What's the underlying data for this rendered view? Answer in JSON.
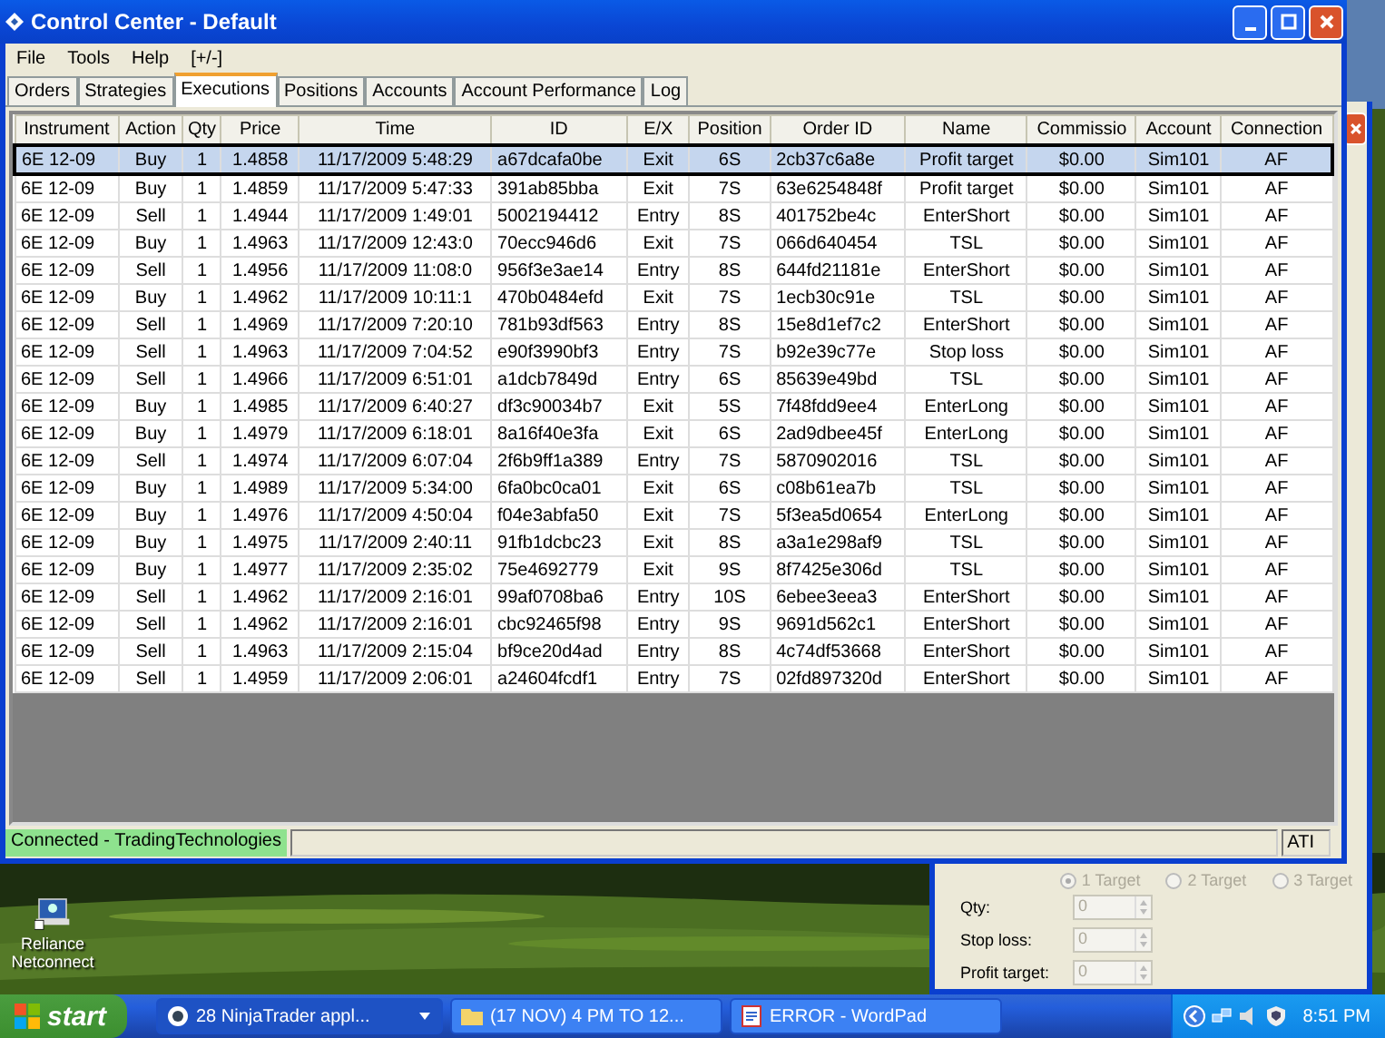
{
  "window": {
    "title": "Control Center - Default"
  },
  "menu": [
    "File",
    "Tools",
    "Help",
    "[+/-]"
  ],
  "tabs": [
    {
      "label": "Orders",
      "selected": false
    },
    {
      "label": "Strategies",
      "selected": false
    },
    {
      "label": "Executions",
      "selected": true
    },
    {
      "label": "Positions",
      "selected": false
    },
    {
      "label": "Accounts",
      "selected": false
    },
    {
      "label": "Account Performance",
      "selected": false
    },
    {
      "label": "Log",
      "selected": false
    }
  ],
  "table": {
    "columns": [
      "Instrument",
      "Action",
      "Qty",
      "Price",
      "Time",
      "ID",
      "E/X",
      "Position",
      "Order ID",
      "Name",
      "Commissio",
      "Account",
      "Connection"
    ],
    "rows": [
      {
        "selected": true,
        "cells": [
          "6E 12-09",
          "Buy",
          "1",
          "1.4858",
          "11/17/2009 5:48:29",
          "a67dcafa0be",
          "Exit",
          "6S",
          "2cb37c6a8e",
          "Profit target",
          "$0.00",
          "Sim101",
          "AF"
        ]
      },
      {
        "selected": false,
        "cells": [
          "6E 12-09",
          "Buy",
          "1",
          "1.4859",
          "11/17/2009 5:47:33",
          "391ab85bba",
          "Exit",
          "7S",
          "63e6254848f",
          "Profit target",
          "$0.00",
          "Sim101",
          "AF"
        ]
      },
      {
        "selected": false,
        "cells": [
          "6E 12-09",
          "Sell",
          "1",
          "1.4944",
          "11/17/2009 1:49:01",
          "5002194412",
          "Entry",
          "8S",
          "401752be4c",
          "EnterShort",
          "$0.00",
          "Sim101",
          "AF"
        ]
      },
      {
        "selected": false,
        "cells": [
          "6E 12-09",
          "Buy",
          "1",
          "1.4963",
          "11/17/2009 12:43:0",
          "70ecc946d6",
          "Exit",
          "7S",
          "066d640454",
          "TSL",
          "$0.00",
          "Sim101",
          "AF"
        ]
      },
      {
        "selected": false,
        "cells": [
          "6E 12-09",
          "Sell",
          "1",
          "1.4956",
          "11/17/2009 11:08:0",
          "956f3e3ae14",
          "Entry",
          "8S",
          "644fd21181e",
          "EnterShort",
          "$0.00",
          "Sim101",
          "AF"
        ]
      },
      {
        "selected": false,
        "cells": [
          "6E 12-09",
          "Buy",
          "1",
          "1.4962",
          "11/17/2009 10:11:1",
          "470b0484efd",
          "Exit",
          "7S",
          "1ecb30c91e",
          "TSL",
          "$0.00",
          "Sim101",
          "AF"
        ]
      },
      {
        "selected": false,
        "cells": [
          "6E 12-09",
          "Sell",
          "1",
          "1.4969",
          "11/17/2009 7:20:10",
          "781b93df563",
          "Entry",
          "8S",
          "15e8d1ef7c2",
          "EnterShort",
          "$0.00",
          "Sim101",
          "AF"
        ]
      },
      {
        "selected": false,
        "cells": [
          "6E 12-09",
          "Sell",
          "1",
          "1.4963",
          "11/17/2009 7:04:52",
          "e90f3990bf3",
          "Entry",
          "7S",
          "b92e39c77e",
          "Stop loss",
          "$0.00",
          "Sim101",
          "AF"
        ]
      },
      {
        "selected": false,
        "cells": [
          "6E 12-09",
          "Sell",
          "1",
          "1.4966",
          "11/17/2009 6:51:01",
          "a1dcb7849d",
          "Entry",
          "6S",
          "85639e49bd",
          "TSL",
          "$0.00",
          "Sim101",
          "AF"
        ]
      },
      {
        "selected": false,
        "cells": [
          "6E 12-09",
          "Buy",
          "1",
          "1.4985",
          "11/17/2009 6:40:27",
          "df3c90034b7",
          "Exit",
          "5S",
          "7f48fdd9ee4",
          "EnterLong",
          "$0.00",
          "Sim101",
          "AF"
        ]
      },
      {
        "selected": false,
        "cells": [
          "6E 12-09",
          "Buy",
          "1",
          "1.4979",
          "11/17/2009 6:18:01",
          "8a16f40e3fa",
          "Exit",
          "6S",
          "2ad9dbee45f",
          "EnterLong",
          "$0.00",
          "Sim101",
          "AF"
        ]
      },
      {
        "selected": false,
        "cells": [
          "6E 12-09",
          "Sell",
          "1",
          "1.4974",
          "11/17/2009 6:07:04",
          "2f6b9ff1a389",
          "Entry",
          "7S",
          "5870902016",
          "TSL",
          "$0.00",
          "Sim101",
          "AF"
        ]
      },
      {
        "selected": false,
        "cells": [
          "6E 12-09",
          "Buy",
          "1",
          "1.4989",
          "11/17/2009 5:34:00",
          "6fa0bc0ca01",
          "Exit",
          "6S",
          "c08b61ea7b",
          "TSL",
          "$0.00",
          "Sim101",
          "AF"
        ]
      },
      {
        "selected": false,
        "cells": [
          "6E 12-09",
          "Buy",
          "1",
          "1.4976",
          "11/17/2009 4:50:04",
          "f04e3abfa50",
          "Exit",
          "7S",
          "5f3ea5d0654",
          "EnterLong",
          "$0.00",
          "Sim101",
          "AF"
        ]
      },
      {
        "selected": false,
        "cells": [
          "6E 12-09",
          "Buy",
          "1",
          "1.4975",
          "11/17/2009 2:40:11",
          "91fb1dcbc23",
          "Exit",
          "8S",
          "a3a1e298af9",
          "TSL",
          "$0.00",
          "Sim101",
          "AF"
        ]
      },
      {
        "selected": false,
        "cells": [
          "6E 12-09",
          "Buy",
          "1",
          "1.4977",
          "11/17/2009 2:35:02",
          "75e4692779",
          "Exit",
          "9S",
          "8f7425e306d",
          "TSL",
          "$0.00",
          "Sim101",
          "AF"
        ]
      },
      {
        "selected": false,
        "cells": [
          "6E 12-09",
          "Sell",
          "1",
          "1.4962",
          "11/17/2009 2:16:01",
          "99af0708ba6",
          "Entry",
          "10S",
          "6ebee3eea3",
          "EnterShort",
          "$0.00",
          "Sim101",
          "AF"
        ]
      },
      {
        "selected": false,
        "cells": [
          "6E 12-09",
          "Sell",
          "1",
          "1.4962",
          "11/17/2009 2:16:01",
          "cbc92465f98",
          "Entry",
          "9S",
          "9691d562c1",
          "EnterShort",
          "$0.00",
          "Sim101",
          "AF"
        ]
      },
      {
        "selected": false,
        "cells": [
          "6E 12-09",
          "Sell",
          "1",
          "1.4963",
          "11/17/2009 2:15:04",
          "bf9ce20d4ad",
          "Entry",
          "8S",
          "4c74df53668",
          "EnterShort",
          "$0.00",
          "Sim101",
          "AF"
        ]
      },
      {
        "selected": false,
        "cells": [
          "6E 12-09",
          "Sell",
          "1",
          "1.4959",
          "11/17/2009 2:06:01",
          "a24604fcdf1",
          "Entry",
          "7S",
          "02fd897320d",
          "EnterShort",
          "$0.00",
          "Sim101",
          "AF"
        ]
      }
    ]
  },
  "status_bar": {
    "connection": "Connected - TradingTechnologies",
    "connected": true,
    "indicator": "ATI"
  },
  "back_window": {
    "targets": [
      {
        "label": "1 Target",
        "selected": true
      },
      {
        "label": "2 Target",
        "selected": false
      },
      {
        "label": "3 Target",
        "selected": false
      }
    ],
    "fields": [
      {
        "label": "Qty:",
        "value": "0"
      },
      {
        "label": "Stop loss:",
        "value": "0"
      },
      {
        "label": "Profit target:",
        "value": "0"
      }
    ]
  },
  "desktop_icons": [
    {
      "label": "Reliance Netconnect"
    }
  ],
  "taskbar": {
    "start": "start",
    "buttons": [
      {
        "label": "28 NinjaTrader appl...",
        "kind": "app",
        "grouped": true
      },
      {
        "label": "(17 NOV) 4 PM TO 12...",
        "kind": "folder",
        "grouped": false
      },
      {
        "label": "ERROR - WordPad",
        "kind": "wordpad",
        "grouped": false
      }
    ],
    "clock": "8:51 PM"
  }
}
